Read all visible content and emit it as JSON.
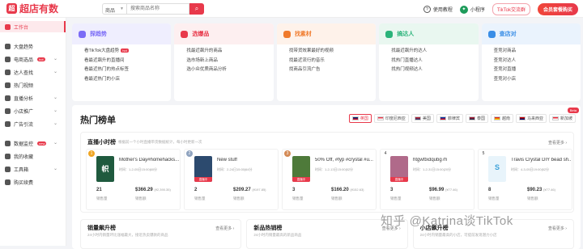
{
  "app": {
    "brand": "超店有数",
    "brand_mark": "超"
  },
  "search": {
    "type_label": "商品",
    "placeholder": "搜索商品名称"
  },
  "topbar": {
    "tutorial": "使用教程",
    "miniprogram": "小程序",
    "tiktok_link": "TikTok交流群",
    "vip_button": "会员套餐购买"
  },
  "sidebar": {
    "items": [
      {
        "label": "工作台",
        "active": true,
        "chevron": false,
        "badge": ""
      },
      {
        "label": "大盘趋势",
        "chevron": false,
        "badge": ""
      },
      {
        "label": "电商选品",
        "chevron": true,
        "badge": "hot"
      },
      {
        "label": "达人查找",
        "chevron": true,
        "badge": ""
      },
      {
        "label": "热门视频",
        "chevron": false,
        "badge": ""
      },
      {
        "label": "直播分析",
        "chevron": true,
        "badge": ""
      },
      {
        "label": "小店推广",
        "chevron": true,
        "badge": ""
      },
      {
        "label": "广告引流",
        "chevron": true,
        "badge": ""
      },
      {
        "label": "数据监控",
        "chevron": true,
        "badge": "new"
      },
      {
        "label": "我的收藏",
        "chevron": false,
        "badge": ""
      },
      {
        "label": "工具箱",
        "chevron": true,
        "badge": ""
      },
      {
        "label": "购买续费",
        "chevron": false,
        "badge": ""
      }
    ]
  },
  "categories": [
    {
      "title": "探趋势",
      "color": "#7b6cf6",
      "bg": "#efeefe",
      "items": [
        "看TikTok大盘趋势",
        "看最近飙升的直播间",
        "看最近热门的热点标签",
        "看最近热门的小店"
      ],
      "hot_index": 0,
      "hot_label": "hot"
    },
    {
      "title": "选爆品",
      "color": "#e8394b",
      "bg": "#fdeff0",
      "items": [
        "找最近飙升的商品",
        "选市场新上商品",
        "选小众优质商品分析"
      ]
    },
    {
      "title": "找素材",
      "color": "#f07a2b",
      "bg": "#fef2ea",
      "items": [
        "找带货效果最好的视频",
        "找最近流行的音乐",
        "找商品引流广告"
      ]
    },
    {
      "title": "搞达人",
      "color": "#2bb37a",
      "bg": "#e9f7f0",
      "items": [
        "找最近飙升的达人",
        "找热门直播达人",
        "找热门视频达人"
      ]
    },
    {
      "title": "查店对",
      "color": "#3a8ee6",
      "bg": "#eaf3fd",
      "items": [
        "查竞对商品",
        "查竞对达人",
        "查竞对直播",
        "查竞对小店"
      ]
    }
  ],
  "hot": {
    "title": "热门榜单",
    "beta": "Beta",
    "regions": [
      {
        "label": "英国",
        "active": true,
        "flag": "uk"
      },
      {
        "label": "印度尼西亚",
        "flag": "id"
      },
      {
        "label": "美国",
        "flag": "us"
      },
      {
        "label": "菲律宾",
        "flag": "ph"
      },
      {
        "label": "泰国",
        "flag": "th"
      },
      {
        "label": "越南",
        "flag": "vn"
      },
      {
        "label": "马来西亚",
        "flag": "my"
      },
      {
        "label": "新加坡",
        "flag": "sg"
      }
    ],
    "live": {
      "title": "直播小时榜",
      "subtitle": "根据前一个小时直播带货数据统计，每小时更新一次",
      "more": "查看更多 ›",
      "cards": [
        {
          "rank": "1",
          "name": "Mother's Day#homehacks...",
          "date": "时间：1-2-05日15:00|60分",
          "count": "21",
          "count_label": "销售量",
          "amount": "$366.29",
          "amount_sub": "(¥2,390.35)",
          "amount_label": "销售额",
          "thumb_color": "#1f5a3e",
          "thumb_text": "帜"
        },
        {
          "rank": "2",
          "name": "New stuff",
          "date": "时间：2-24日15:00|64分",
          "count": "2",
          "count_label": "销售量",
          "amount": "$209.27",
          "amount_sub": "(¥197.85)",
          "amount_label": "销售额",
          "thumb_color": "#2c4a6e",
          "thumb_text": "",
          "live_tag": "直播中"
        },
        {
          "rank": "3",
          "name": "50% Off, #fyp #crystal #u...",
          "date": "时间：1-2-13日15:00|52分",
          "count": "3",
          "count_label": "销售量",
          "amount": "$166.20",
          "amount_sub": "(¥152.63)",
          "amount_label": "销售额",
          "thumb_color": "#4e7a3a",
          "thumb_text": "",
          "live_tag": "直播中"
        },
        {
          "rank": "4",
          "name": "htgwttxdqubg7h",
          "date": "时间：1-2-31日15:00|20分",
          "count": "3",
          "count_label": "销售量",
          "amount": "$96.99",
          "amount_sub": "(¥77.46)",
          "amount_label": "销售额",
          "thumb_color": "#b06a8a",
          "thumb_text": "",
          "live_tag": "直播中"
        },
        {
          "rank": "5",
          "name": "Travis Crystal DIY bead sh...",
          "date": "时间：4-3-05日19:00|52分",
          "count": "8",
          "count_label": "销售量",
          "amount": "$90.23",
          "amount_sub": "(¥77.46)",
          "amount_label": "销售额",
          "thumb_color": "#e8f4fb",
          "thumb_text": "S"
        }
      ]
    },
    "bottom": [
      {
        "title": "销量飙升榜",
        "subtitle": "24小时内销量环比涨幅最大，接近热卖爆款的商品",
        "more": "查看更多 ›"
      },
      {
        "title": "新品热销榜",
        "subtitle": "24小时内销量最高的新品商品",
        "more": "查看更多 ›"
      },
      {
        "title": "小店飙升榜",
        "subtitle": "24小时内销量最高的小店，可提前发现潜力小店",
        "more": "查看更多 ›"
      }
    ]
  },
  "watermark": "知乎 @Katrina谈TikTok"
}
